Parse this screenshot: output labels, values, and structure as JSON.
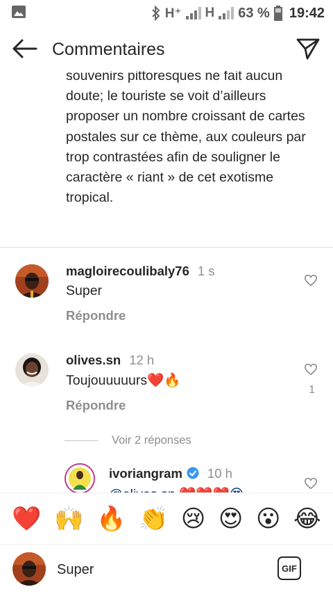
{
  "status_bar": {
    "network_1": "H⁺",
    "network_2": "H",
    "battery": "63 %",
    "time": "19:42"
  },
  "header": {
    "title": "Commentaires"
  },
  "caption": {
    "text": "souvenirs pittoresques ne fait aucun doute; le touriste se voit d’ailleurs proposer un nombre croissant de cartes postales sur ce thème, aux couleurs par trop contrastées afin de souligner le caractère « riant » de cet exotisme tropical."
  },
  "comments": [
    {
      "username": "magloirecoulibaly76",
      "time": "1 s",
      "text": "Super",
      "reply_label": "Répondre",
      "likes": ""
    },
    {
      "username": "olives.sn",
      "time": "12 h",
      "text": "Toujouuuuurs❤️🔥",
      "reply_label": "Répondre",
      "likes": "1"
    }
  ],
  "view_replies": "Voir 2 réponses",
  "nested_reply": {
    "username": "ivoriangram",
    "time": "10 h",
    "text": "@olives.sn ❤️❤️❤️😍"
  },
  "emoji_bar": [
    "❤️",
    "🙌",
    "🔥",
    "👏",
    "😢",
    "😍",
    "😮",
    "😂"
  ],
  "composer": {
    "value": "Super",
    "gif_label": "GIF"
  },
  "colors": {
    "text": "#262626",
    "secondary": "#8e8e8e",
    "verified": "#3897f0",
    "heart": "#ed4956"
  }
}
